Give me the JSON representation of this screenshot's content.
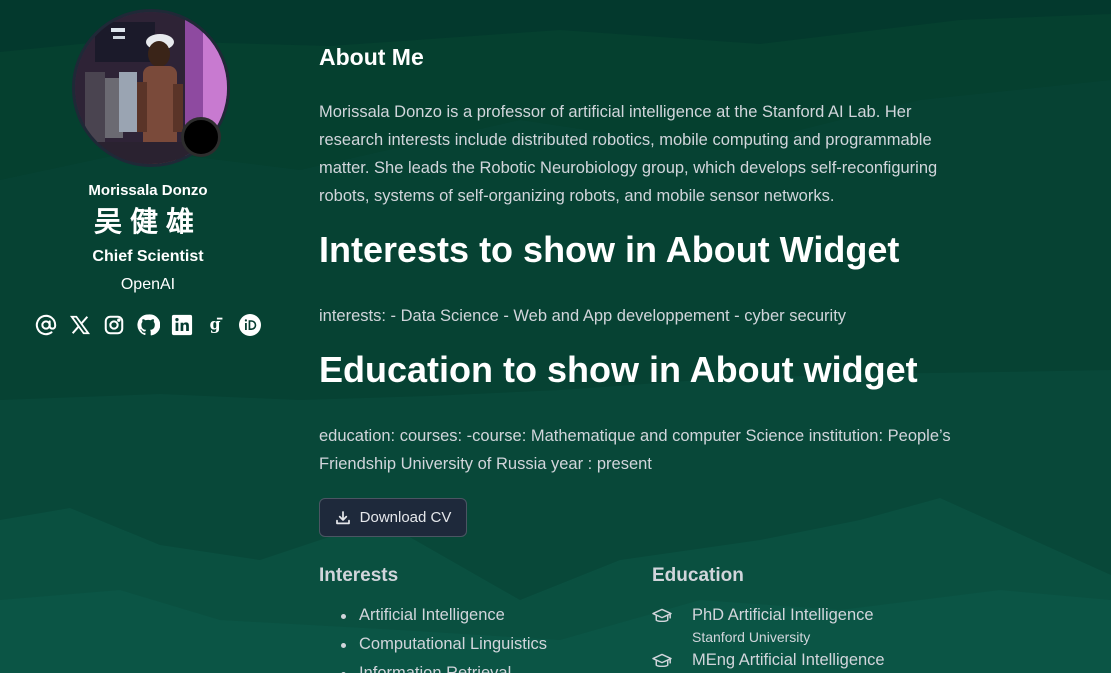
{
  "theme": {
    "background": "#053b30",
    "accent_text": "#ffffff",
    "body_text": "#d1d5db",
    "button_bg": "#1e293b"
  },
  "profile": {
    "name": "Morissala Donzo",
    "name_cjk": "吴健雄",
    "role": "Chief Scientist",
    "organization": "OpenAI",
    "status_color": "#000000",
    "socials": [
      {
        "icon": "at-sign-icon"
      },
      {
        "icon": "x-twitter-icon"
      },
      {
        "icon": "instagram-icon"
      },
      {
        "icon": "github-icon"
      },
      {
        "icon": "linkedin-icon"
      },
      {
        "icon": "google-scholar-icon"
      },
      {
        "icon": "orcid-icon"
      }
    ]
  },
  "about": {
    "heading": "About Me",
    "bio": "Morissala Donzo is a professor of artificial intelligence at the Stanford AI Lab. Her research interests include distributed robotics, mobile computing and programmable matter. She leads the Robotic Neurobiology group, which develops self-reconfiguring robots, systems of self-organizing robots, and mobile sensor networks."
  },
  "interests_section": {
    "heading": "Interests to show in About Widget",
    "text": "interests: - Data Science - Web and App developpement - cyber security"
  },
  "education_section": {
    "heading": "Education to show in About widget",
    "text": "education: courses: -course: Mathematique and computer Science institution: People’s Friendship University of Russia year : present"
  },
  "cv_button": {
    "label": "Download CV",
    "icon": "download-icon"
  },
  "interests": {
    "title": "Interests",
    "items": [
      "Artificial Intelligence",
      "Computational Linguistics",
      "Information Retrieval"
    ]
  },
  "education": {
    "title": "Education",
    "items": [
      {
        "degree": "PhD Artificial Intelligence",
        "institution": "Stanford University",
        "icon": "graduation-cap-icon"
      },
      {
        "degree": "MEng Artificial Intelligence",
        "institution": "",
        "icon": "graduation-cap-icon"
      }
    ]
  }
}
